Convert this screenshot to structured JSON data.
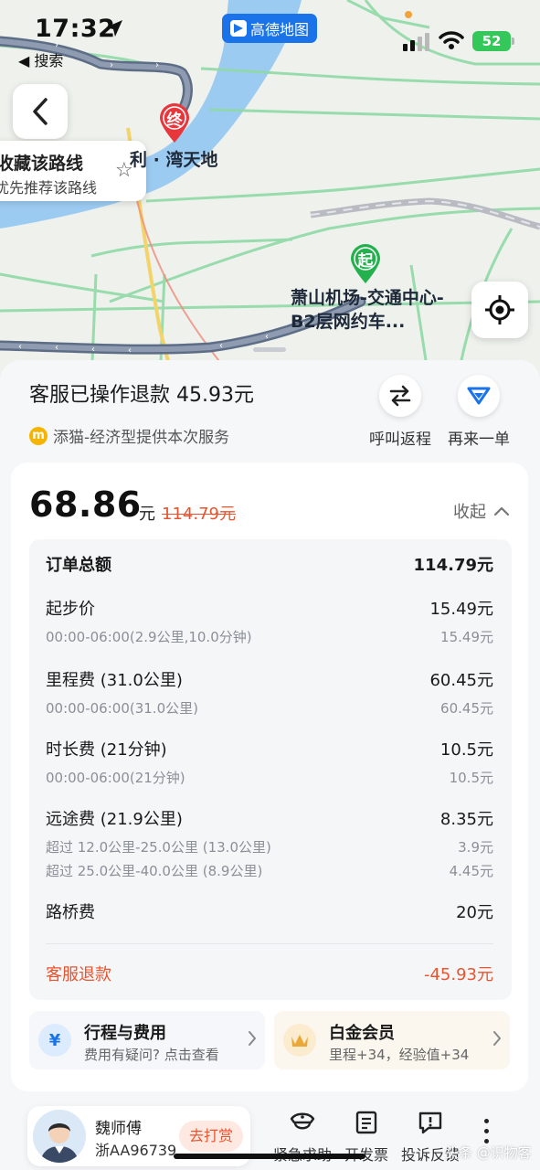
{
  "status": {
    "time": "17:32",
    "back_app": "◀ 搜索",
    "app_badge": "高德地图",
    "battery": "52"
  },
  "map": {
    "favorite_title": "收藏该路线",
    "favorite_sub": "优先推荐该路线",
    "end_pin": "终",
    "end_label": "利 · 湾天地",
    "start_pin": "起",
    "start_label": "萧山机场-交通中心-B2层网约车..."
  },
  "summary": {
    "refund_text": "客服已操作退款 45.93元",
    "provider_icon": "m",
    "provider_text": "添猫-经济型提供本次服务",
    "action_return": "呼叫返程",
    "action_reorder": "再来一单"
  },
  "fare": {
    "price": "68.86",
    "unit": "元",
    "original": "114.79元",
    "collapse_label": "收起",
    "rows": [
      {
        "label": "订单总额",
        "value": "114.79元"
      },
      {
        "label": "起步价",
        "value": "15.49元"
      },
      {
        "label": "00:00-06:00(2.9公里,10.0分钟)",
        "value": "15.49元"
      },
      {
        "label": "里程费 (31.0公里)",
        "value": "60.45元"
      },
      {
        "label": "00:00-06:00(31.0公里)",
        "value": "60.45元"
      },
      {
        "label": "时长费 (21分钟)",
        "value": "10.5元"
      },
      {
        "label": "00:00-06:00(21分钟)",
        "value": "10.5元"
      },
      {
        "label": "远途费 (21.9公里)",
        "value": "8.35元"
      },
      {
        "label": "超过 12.0公里-25.0公里 (13.0公里)",
        "value": "3.9元"
      },
      {
        "label": "超过 25.0公里-40.0公里 (8.9公里)",
        "value": "4.45元"
      },
      {
        "label": "路桥费",
        "value": "20元"
      },
      {
        "label": "客服退款",
        "value": "-45.93元"
      }
    ],
    "promo_trip_title": "行程与费用",
    "promo_trip_sub": "费用有疑问? 点击查看",
    "promo_vip_title": "白金会员",
    "promo_vip_sub": "里程+34，经验值+34"
  },
  "bottom": {
    "driver_name": "魏师傅",
    "plate": "浙AA96739",
    "tip_label": "去打赏",
    "tool_emergency": "紧急求助",
    "tool_invoice": "开发票",
    "tool_complaint": "投诉反馈",
    "watermark": "头条 @识物客"
  },
  "colors": {
    "accent_red": "#e8542f",
    "route_blue": "#1a73e8",
    "start_green": "#22b14c",
    "end_red": "#e8363d"
  }
}
